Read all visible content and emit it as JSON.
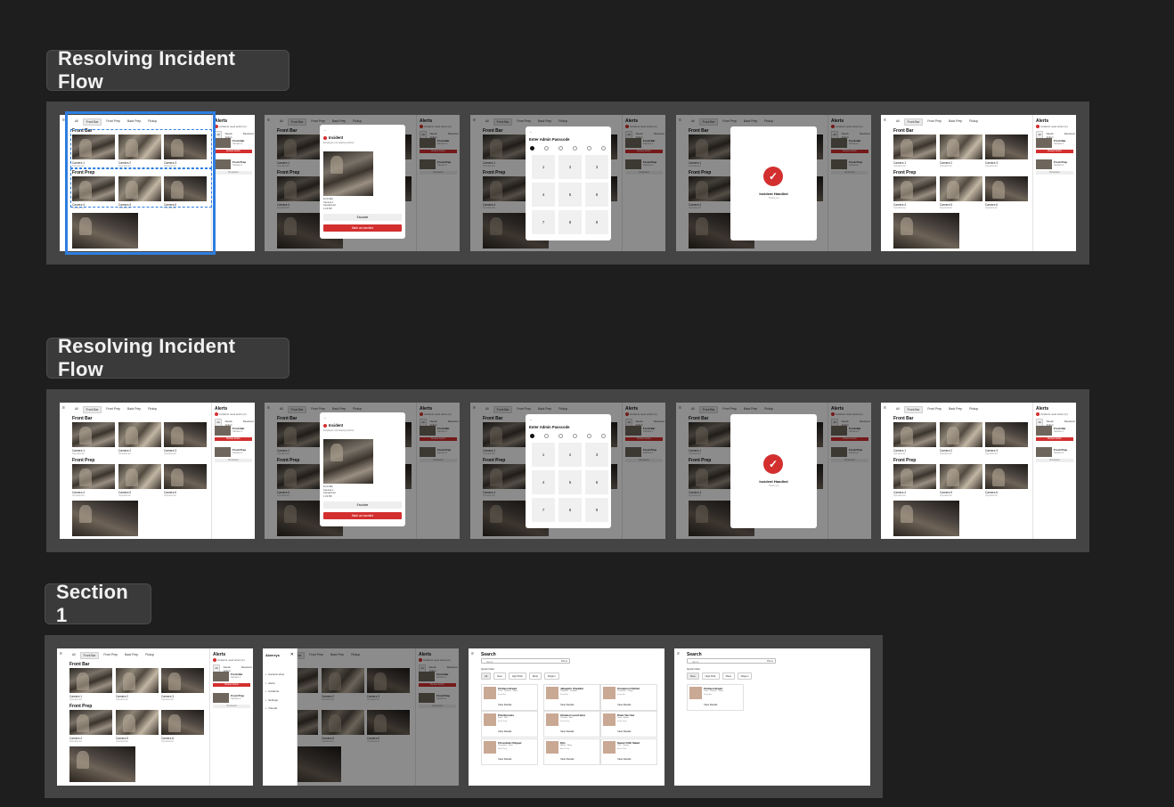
{
  "canvas": {
    "sections": [
      {
        "label": "Resolving Incident Flow"
      },
      {
        "label": "Resolving Incident Flow"
      },
      {
        "label": "Section 1"
      }
    ]
  },
  "app": {
    "menu_icon": "≡",
    "tabs": [
      "All",
      "Front Bar",
      "Front Prep",
      "Back Prep",
      "Pickup"
    ],
    "active_tab": "Front Bar",
    "front_bar_heading": "Front Bar",
    "front_prep_heading": "Front Prep",
    "cameras": [
      {
        "name": "Camera 1",
        "status": "Operational"
      },
      {
        "name": "Camera 2",
        "status": "Operational"
      },
      {
        "name": "Camera 3",
        "status": "Operational"
      },
      {
        "name": "Camera 4",
        "status": "Operational"
      },
      {
        "name": "Camera 5",
        "status": "Operational"
      },
      {
        "name": "Camera 6",
        "status": "Operational"
      }
    ],
    "alerts": {
      "title": "Alerts",
      "subtitle": "Incidents need action (1)",
      "tabs": [
        "All",
        "Needs Action",
        "Resolved"
      ],
      "cards": [
        {
          "title": "Front Bar",
          "meta": "Camera 1",
          "button": "Review Action"
        },
        {
          "title": "Front Prep",
          "meta": "Camera 4",
          "button": "Reviewed"
        }
      ]
    },
    "incident": {
      "back": "←",
      "title": "Incident",
      "text": "Employee not wearing hairnet",
      "info": [
        "Front Bar",
        "Camera 1",
        "Operational",
        "1:23 PM"
      ],
      "escalate": "Escalate",
      "handled": "Mark as handled"
    },
    "passcode": {
      "back": "←",
      "title": "Enter Admin Passcode",
      "keys": [
        "1",
        "2",
        "3",
        "4",
        "5",
        "6",
        "7",
        "8",
        "9"
      ]
    },
    "handled": {
      "check": "✓",
      "title": "Incident Handled",
      "sub": "Thank you"
    },
    "sidenav": {
      "logo": "Alzerrys",
      "close": "✕",
      "items": [
        "Camera View",
        "Alerts",
        "Incidents",
        "Settings",
        "Tutorial"
      ]
    },
    "search": {
      "title": "Search",
      "placeholder": "Items",
      "filter": "Filters",
      "quick_filter_label": "Quick Filter",
      "chips": [
        "All",
        "New",
        "High Risk",
        "Meal",
        "Wagon"
      ],
      "chips_short": [
        "New",
        "High Risk",
        "Meal",
        "Wagon"
      ],
      "results": [
        {
          "title": "Chicken Bread",
          "tags": "Tuna · Chicken · Naan",
          "meta": "Front Bar",
          "button": "View Details"
        },
        {
          "title": "Jalapeño Cheddar",
          "tags": "Jalapeño · Cheddar",
          "meta": "Front Bar",
          "button": "View Details"
        },
        {
          "title": "Cinnamon Parfait",
          "tags": "Cinnamon · Sugar",
          "meta": "Front Bar",
          "button": "View Details"
        },
        {
          "title": "Pita Biscuits",
          "tags": "Flour · Salt",
          "meta": "Front Prep",
          "button": "View Details"
        },
        {
          "title": "Chicken Lunch Box",
          "tags": "Chicken · Rice",
          "meta": "Front Prep",
          "button": "View Details"
        },
        {
          "title": "Plum Tart Set",
          "tags": "Plum · Butter",
          "meta": "Front Prep",
          "button": "View Details"
        },
        {
          "title": "Chocolate Chipper",
          "tags": "Chocolate · Flour",
          "meta": "Back Prep",
          "button": "View Details"
        },
        {
          "title": "Kits",
          "tags": "Mixed · Wrap",
          "meta": "Back Prep",
          "button": "View Details"
        },
        {
          "title": "Sweet Chili Salad",
          "tags": "Chili · Greens",
          "meta": "Back Prep",
          "button": "View Details"
        }
      ]
    }
  }
}
